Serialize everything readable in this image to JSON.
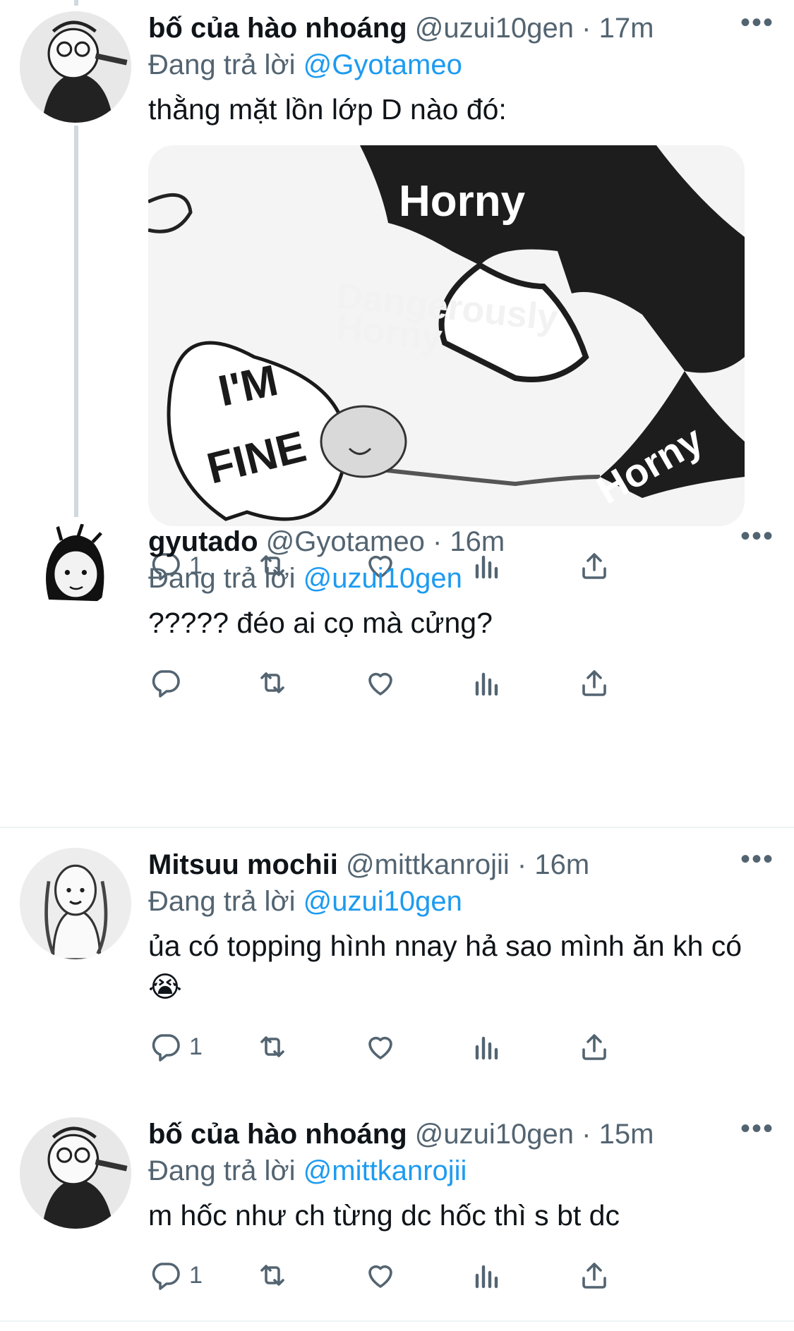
{
  "reply_prefix": "Đang trả lời",
  "more_label": "•••",
  "colors": {
    "link": "#1d9bf0",
    "secondary": "#536471",
    "thread_line": "#cfd9de"
  },
  "tweets": [
    {
      "name": "bố của hào nhoáng",
      "handle": "@uzui10gen",
      "time": "17m",
      "reply_to": "@Gyotameo",
      "text": "thằng mặt lồn lớp D nào đó:",
      "media_labels": [
        "I'M",
        "FINE",
        "Horny",
        "Dangerously",
        "Horny",
        "Horny"
      ],
      "counts": {
        "reply": "1",
        "retweet": "",
        "like": "",
        "views": ""
      }
    },
    {
      "name": "gyutado",
      "handle": "@Gyotameo",
      "time": "16m",
      "reply_to": "@uzui10gen",
      "text": "????? đéo ai cọ mà cửng?",
      "counts": {
        "reply": "",
        "retweet": "",
        "like": "",
        "views": ""
      }
    },
    {
      "name": "Mitsuu mochii",
      "handle": "@mittkanrojii",
      "time": "16m",
      "reply_to": "@uzui10gen",
      "text": "ủa có topping hình nnay hả sao mình ăn kh có😭",
      "counts": {
        "reply": "1",
        "retweet": "",
        "like": "",
        "views": ""
      }
    },
    {
      "name": "bố của hào nhoáng",
      "handle": "@uzui10gen",
      "time": "15m",
      "reply_to": "@mittkanrojii",
      "text": "m hốc như ch từng dc hốc thì s bt dc",
      "counts": {
        "reply": "1",
        "retweet": "",
        "like": "",
        "views": ""
      }
    }
  ]
}
